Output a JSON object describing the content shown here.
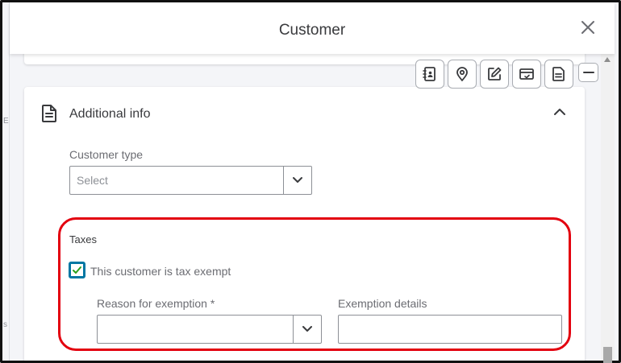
{
  "header": {
    "title": "Customer"
  },
  "left_fragments": [
    "E",
    "s"
  ],
  "section": {
    "title": "Additional info",
    "customer_type_label": "Customer type",
    "customer_type_placeholder": "Select"
  },
  "taxes": {
    "title": "Taxes",
    "tax_exempt_label": "This customer is tax exempt",
    "tax_exempt_checked": true,
    "reason_label": "Reason for exemption *",
    "reason_value": "",
    "details_label": "Exemption details",
    "details_value": ""
  },
  "toolbar": {
    "buttons": [
      "contact-book-icon",
      "location-pin-icon",
      "edit-note-icon",
      "payment-card-icon",
      "document-icon",
      "minimize-icon"
    ]
  },
  "colors": {
    "checkbox_border": "#0077a3",
    "checkmark": "#2ca01c",
    "highlight": "#e3000f"
  }
}
